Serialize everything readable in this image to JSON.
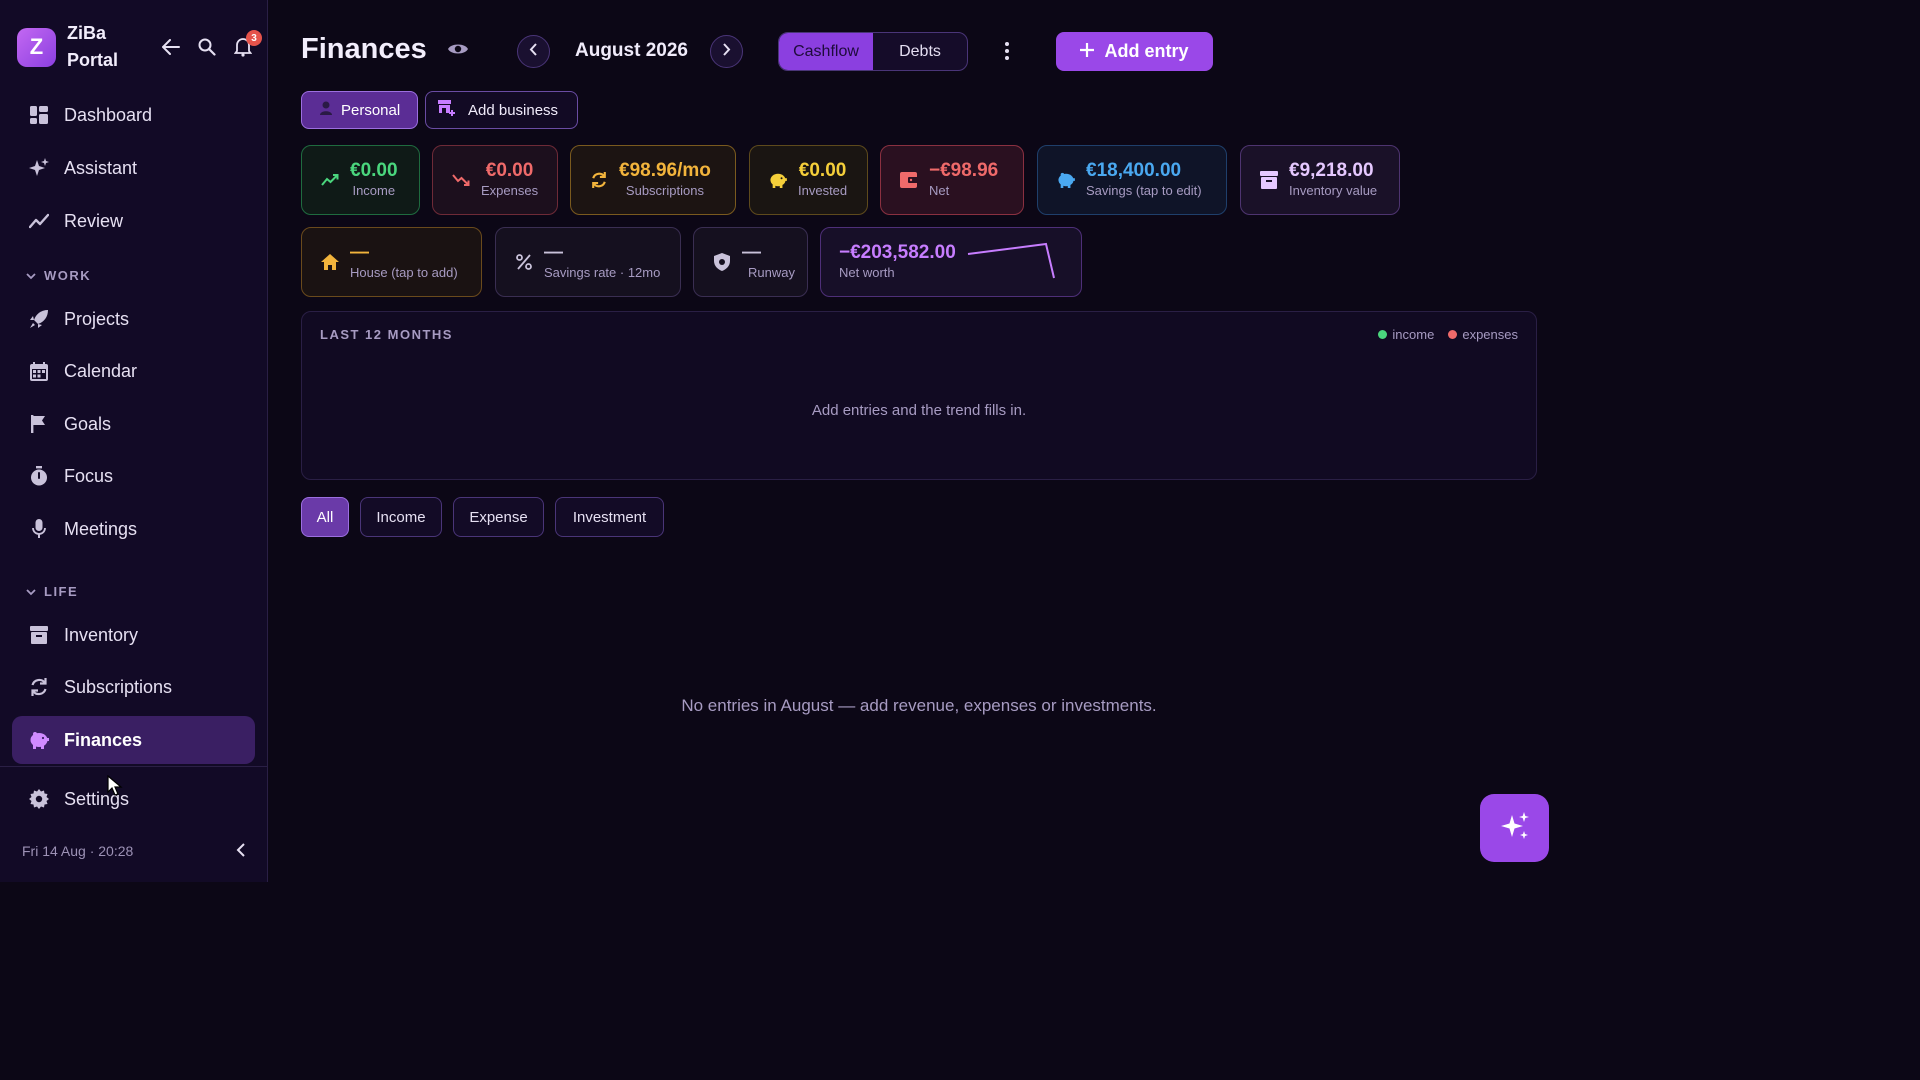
{
  "app": {
    "logo_letter": "Z",
    "name": "ZiBa Portal",
    "notification_count": "3"
  },
  "sidebar": {
    "items_top": [
      {
        "label": "Dashboard",
        "icon": "dashboard-icon"
      },
      {
        "label": "Assistant",
        "icon": "sparkle-icon"
      },
      {
        "label": "Review",
        "icon": "trend-icon"
      }
    ],
    "section_work": "WORK",
    "items_work": [
      {
        "label": "Projects",
        "icon": "rocket-icon"
      },
      {
        "label": "Calendar",
        "icon": "calendar-icon"
      },
      {
        "label": "Goals",
        "icon": "flag-icon"
      },
      {
        "label": "Focus",
        "icon": "timer-icon"
      },
      {
        "label": "Meetings",
        "icon": "mic-icon"
      }
    ],
    "section_life": "LIFE",
    "items_life": [
      {
        "label": "Inventory",
        "icon": "archive-icon"
      },
      {
        "label": "Subscriptions",
        "icon": "refresh-icon"
      },
      {
        "label": "Finances",
        "icon": "piggy-bank-icon",
        "active": true
      }
    ],
    "settings_label": "Settings",
    "footer": "Fri 14 Aug · 20:28"
  },
  "header": {
    "title": "Finances",
    "month": "August 2026",
    "tabs": [
      "Cashflow",
      "Debts"
    ],
    "active_tab": "Cashflow",
    "add_entry": "Add entry"
  },
  "scope": {
    "personal": "Personal",
    "add_business": "Add business"
  },
  "stats": {
    "income": {
      "value": "€0.00",
      "label": "Income",
      "color": "#4ad67d"
    },
    "expenses": {
      "value": "€0.00",
      "label": "Expenses",
      "color": "#ef6a6a"
    },
    "subscriptions": {
      "value": "€98.96/mo",
      "label": "Subscriptions",
      "color": "#f2b43c"
    },
    "invested": {
      "value": "€0.00",
      "label": "Invested",
      "color": "#f5cf3a"
    },
    "net": {
      "value": "−€98.96",
      "label": "Net",
      "color": "#ef6a6a"
    },
    "savings": {
      "value": "€18,400.00",
      "label": "Savings (tap to edit)",
      "color": "#4aa8f0"
    },
    "inventory": {
      "value": "€9,218.00",
      "label": "Inventory value",
      "color": "#e5c8ff"
    },
    "house": {
      "value": "—",
      "label": "House (tap to add)",
      "color": "#f2b43c"
    },
    "savings_rate": {
      "value": "—",
      "label": "Savings rate · 12mo",
      "color": "#c9c2da"
    },
    "runway": {
      "value": "—",
      "label": "Runway",
      "color": "#c9c2da"
    },
    "net_worth": {
      "value": "−€203,582.00",
      "label": "Net worth",
      "color": "#c77dff"
    }
  },
  "trend": {
    "title": "LAST 12 MONTHS",
    "legend": [
      {
        "name": "income",
        "color": "#4ad67d"
      },
      {
        "name": "expenses",
        "color": "#ef6a6a"
      }
    ],
    "empty": "Add entries and the trend fills in."
  },
  "filters": [
    "All",
    "Income",
    "Expense",
    "Investment"
  ],
  "active_filter": "All",
  "empty_message": "No entries in August — add revenue, expenses or investments."
}
